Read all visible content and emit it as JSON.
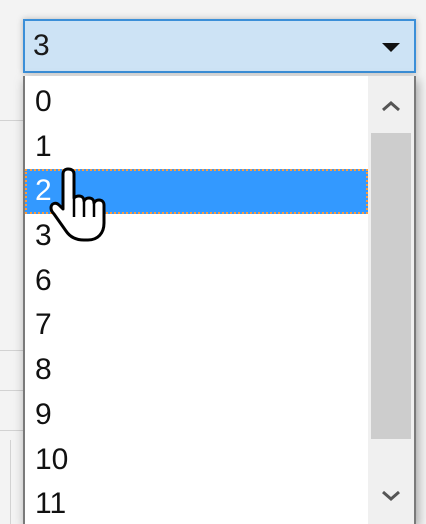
{
  "select": {
    "value": "3",
    "arrow_icon": "dropdown-arrow-icon"
  },
  "dropdown": {
    "options": [
      "0",
      "1",
      "2",
      "3",
      "6",
      "7",
      "8",
      "9",
      "10",
      "11"
    ],
    "selected_index": 2,
    "scroll_up_icon": "chevron-up-icon",
    "scroll_down_icon": "chevron-down-icon"
  },
  "cursor": {
    "icon": "hand-pointer-icon"
  },
  "colors": {
    "select_bg": "#cde3f5",
    "select_border": "#3b8fd8",
    "selected_bg": "#3399ff",
    "focus_outline": "#ff9b3a",
    "scroll_thumb": "#cdcdcd"
  }
}
